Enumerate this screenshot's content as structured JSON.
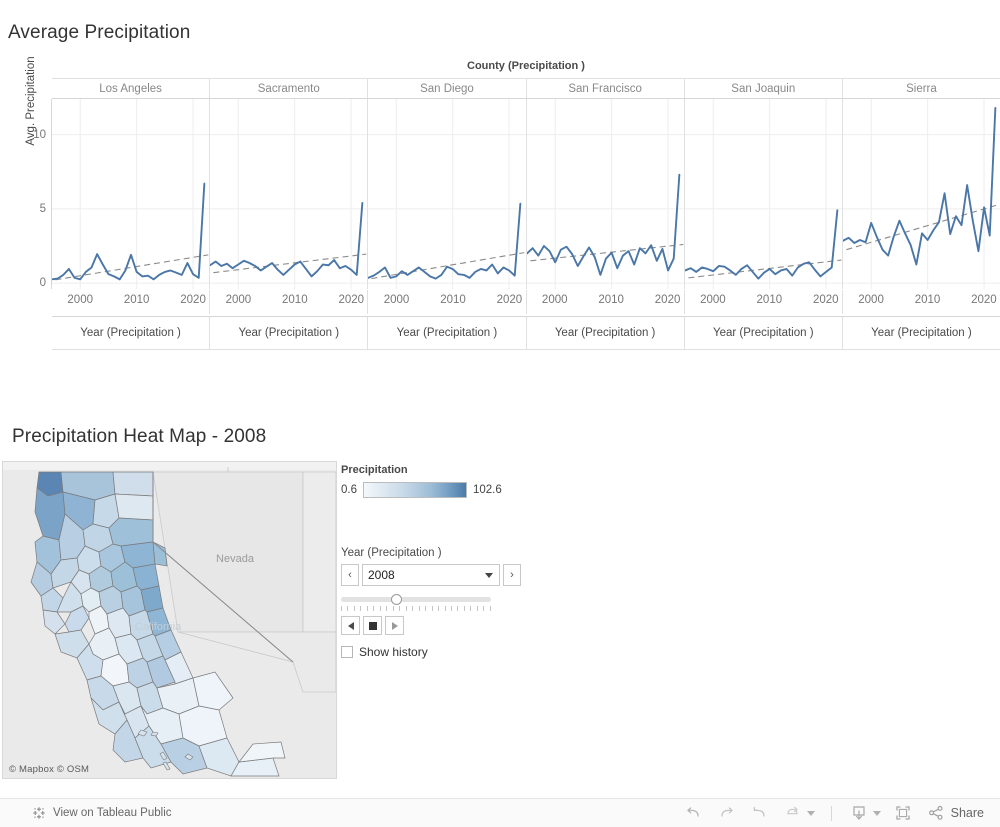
{
  "precip_sheet": {
    "title": "Average Precipitation",
    "column_field_label": "County (Precipitation )",
    "y_axis_title": "Avg. Precipitation",
    "x_axis_title": "Year (Precipitation )",
    "y_ticks": [
      "0",
      "5",
      "10"
    ],
    "x_ticks": [
      "2000",
      "2010",
      "2020"
    ],
    "panels": [
      "Los Angeles",
      "Sacramento",
      "San Diego",
      "San Francisco",
      "San Joaquin",
      "Sierra"
    ]
  },
  "map_sheet": {
    "title": "Precipitation Heat Map  - 2008",
    "attribution": "© Mapbox  © OSM",
    "map_labels": [
      "Nevada",
      "California"
    ],
    "legend": {
      "title": "Precipitation",
      "min": "0.6",
      "max": "102.6",
      "ramp_low": "#f4f8fb",
      "ramp_high": "#4b7ba8"
    },
    "year_filter": {
      "label": "Year (Precipitation )",
      "value": "2008",
      "prev_label": "‹",
      "next_label": "›",
      "show_history_label": "Show history",
      "show_history_checked": false,
      "slider_position_pct": 36
    }
  },
  "toolbar": {
    "tableau_link_label": "View on Tableau Public",
    "share_label": "Share",
    "buttons": [
      "undo",
      "redo",
      "revert",
      "refresh",
      "download",
      "fullscreen"
    ]
  },
  "chart_data": {
    "type": "line",
    "title": "Average Precipitation",
    "xlabel": "Year (Precipitation )",
    "ylabel": "Avg. Precipitation",
    "ylim": [
      -0.4,
      12.4
    ],
    "xlim": [
      1995,
      2023
    ],
    "grid": true,
    "legend_position": "none",
    "line_color": "#4a76a8",
    "trend_color": "#8a8a8a",
    "facet_field": "County (Precipitation )",
    "x": [
      1995,
      1996,
      1997,
      1998,
      1999,
      2000,
      2001,
      2002,
      2003,
      2004,
      2005,
      2006,
      2007,
      2008,
      2009,
      2010,
      2011,
      2012,
      2013,
      2014,
      2015,
      2016,
      2017,
      2018,
      2019,
      2020,
      2021,
      2022
    ],
    "series": [
      {
        "name": "Los Angeles",
        "values": [
          0.25,
          0.3,
          0.55,
          0.95,
          0.35,
          0.25,
          0.75,
          1.05,
          1.95,
          1.25,
          0.6,
          0.45,
          0.25,
          0.85,
          1.9,
          0.75,
          0.45,
          0.5,
          0.25,
          0.55,
          0.75,
          0.85,
          0.7,
          0.55,
          1.35,
          0.6,
          0.35,
          6.7
        ],
        "trend": [
          0.22,
          1.9
        ]
      },
      {
        "name": "Sacramento",
        "values": [
          1.2,
          1.45,
          1.15,
          1.3,
          1.0,
          1.25,
          1.5,
          1.35,
          1.15,
          0.85,
          1.1,
          1.35,
          0.9,
          0.55,
          0.9,
          1.25,
          1.45,
          0.95,
          0.45,
          0.8,
          1.25,
          1.2,
          1.55,
          1.0,
          1.15,
          0.9,
          0.55,
          5.4
        ],
        "trend": [
          0.7,
          1.95
        ]
      },
      {
        "name": "San Diego",
        "values": [
          0.35,
          0.5,
          0.75,
          1.05,
          0.35,
          0.45,
          0.8,
          0.55,
          0.8,
          1.05,
          0.75,
          0.45,
          0.3,
          0.55,
          1.1,
          0.95,
          0.6,
          0.55,
          0.35,
          0.75,
          0.95,
          0.85,
          1.25,
          0.65,
          1.05,
          0.85,
          0.5,
          5.35
        ],
        "trend": [
          0.3,
          2.05
        ]
      },
      {
        "name": "San Francisco",
        "values": [
          2.0,
          2.35,
          1.85,
          2.5,
          2.15,
          1.4,
          2.25,
          2.45,
          1.95,
          1.15,
          1.8,
          2.4,
          1.75,
          0.55,
          1.65,
          2.05,
          1.0,
          1.85,
          2.15,
          1.25,
          2.35,
          2.0,
          2.55,
          1.5,
          2.3,
          0.85,
          1.65,
          7.3
        ],
        "trend": [
          1.5,
          2.6
        ]
      },
      {
        "name": "San Joaquin",
        "values": [
          0.85,
          1.0,
          0.75,
          1.05,
          0.95,
          0.8,
          1.15,
          1.1,
          0.85,
          0.55,
          0.95,
          1.2,
          0.75,
          0.3,
          0.7,
          0.95,
          0.6,
          0.85,
          0.95,
          0.5,
          1.05,
          1.3,
          1.4,
          0.9,
          0.45,
          0.75,
          1.05,
          4.9
        ],
        "trend": [
          0.35,
          1.55
        ]
      },
      {
        "name": "Sierra",
        "values": [
          2.85,
          3.05,
          2.7,
          2.9,
          2.75,
          4.05,
          3.1,
          2.25,
          1.85,
          3.15,
          4.2,
          3.35,
          2.55,
          1.25,
          3.35,
          2.9,
          3.55,
          4.1,
          6.05,
          3.3,
          4.5,
          3.9,
          6.6,
          4.2,
          2.15,
          5.1,
          3.2,
          11.8
        ],
        "trend": [
          2.25,
          5.3
        ]
      }
    ]
  }
}
